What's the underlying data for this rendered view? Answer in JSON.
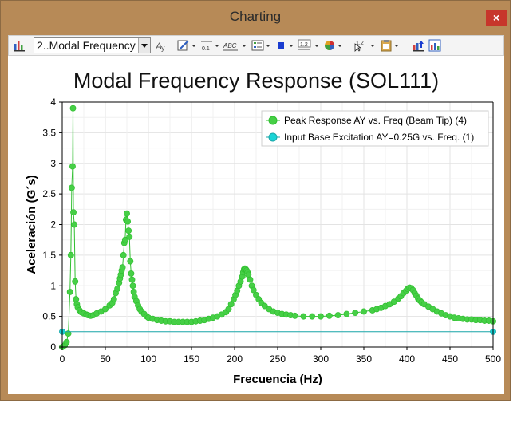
{
  "window": {
    "title": "Charting",
    "close_label": "×"
  },
  "toolbar": {
    "selected_chart": "2..Modal Frequency",
    "icons": [
      "bar-chart-icon",
      "font-icon",
      "edit-icon",
      "axis-format-icon",
      "text-label-icon",
      "legend-icon",
      "marker-icon",
      "range-icon",
      "color-icon",
      "cursor-icon",
      "clipboard-icon",
      "export-icon",
      "chart-settings-icon"
    ],
    "icon_labels": {
      "range": "1.2",
      "cursor": "1.2",
      "axis": "0.1",
      "text": "ABC"
    }
  },
  "colors": {
    "series1": "#2fbf2f",
    "series1_fill": "#46cf46",
    "series2": "#1aa7a9",
    "series2_fill": "#19d4d6",
    "grid": "#e3e3e3"
  },
  "chart_data": {
    "type": "line",
    "title": "Modal Frequency Response (SOL111)",
    "xlabel": "Frecuencia (Hz)",
    "ylabel": "Aceleración (G´s)",
    "xlim": [
      0,
      500
    ],
    "ylim": [
      0,
      4
    ],
    "xticks": [
      "0",
      "50",
      "100",
      "150",
      "200",
      "250",
      "300",
      "350",
      "400",
      "450",
      "500"
    ],
    "yticks": [
      "0",
      "0.5",
      "1",
      "1.5",
      "2",
      "2.5",
      "3",
      "3.5",
      "4"
    ],
    "grid": true,
    "legend_position": "top-right",
    "series": [
      {
        "name": "Peak Response AY vs. Freq (Beam Tip) (4)",
        "x": [
          0,
          3,
          5,
          7,
          9,
          10,
          11,
          12,
          12.5,
          13,
          14,
          15,
          16,
          17,
          18,
          20,
          22,
          25,
          28,
          30,
          33,
          36,
          40,
          45,
          50,
          55,
          58,
          60,
          62,
          64,
          66,
          67,
          68,
          69,
          70,
          71,
          72,
          73,
          74,
          75,
          76,
          77,
          78,
          79,
          80,
          81,
          82,
          83,
          84,
          86,
          88,
          90,
          92,
          95,
          98,
          100,
          105,
          110,
          115,
          120,
          125,
          130,
          135,
          140,
          145,
          150,
          155,
          160,
          165,
          170,
          175,
          180,
          185,
          190,
          193,
          196,
          199,
          201,
          203,
          205,
          207,
          209,
          210,
          211,
          212,
          213,
          214,
          215,
          216,
          218,
          220,
          222,
          225,
          228,
          231,
          235,
          240,
          245,
          250,
          255,
          260,
          265,
          270,
          280,
          290,
          300,
          310,
          320,
          330,
          340,
          350,
          360,
          365,
          370,
          375,
          380,
          385,
          390,
          393,
          396,
          399,
          401,
          403,
          405,
          407,
          409,
          411,
          413,
          415,
          417,
          420,
          425,
          430,
          435,
          440,
          445,
          450,
          455,
          460,
          465,
          470,
          475,
          480,
          485,
          490,
          495,
          500
        ],
        "y": [
          0.0,
          0.03,
          0.08,
          0.22,
          0.9,
          1.5,
          2.6,
          2.95,
          3.9,
          2.2,
          2.0,
          1.07,
          0.78,
          0.7,
          0.65,
          0.6,
          0.57,
          0.55,
          0.53,
          0.52,
          0.51,
          0.52,
          0.55,
          0.58,
          0.62,
          0.68,
          0.72,
          0.78,
          0.88,
          0.95,
          1.05,
          1.12,
          1.18,
          1.25,
          1.3,
          1.5,
          1.7,
          1.75,
          2.08,
          2.18,
          2.05,
          1.9,
          1.8,
          1.4,
          1.2,
          1.1,
          1.0,
          0.9,
          0.82,
          0.75,
          0.68,
          0.62,
          0.58,
          0.54,
          0.5,
          0.48,
          0.46,
          0.44,
          0.43,
          0.42,
          0.42,
          0.41,
          0.41,
          0.41,
          0.41,
          0.41,
          0.42,
          0.43,
          0.44,
          0.46,
          0.48,
          0.5,
          0.53,
          0.57,
          0.62,
          0.7,
          0.78,
          0.85,
          0.92,
          1.0,
          1.07,
          1.15,
          1.22,
          1.27,
          1.28,
          1.27,
          1.25,
          1.22,
          1.18,
          1.1,
          1.0,
          0.93,
          0.85,
          0.78,
          0.72,
          0.67,
          0.62,
          0.58,
          0.56,
          0.54,
          0.53,
          0.52,
          0.51,
          0.5,
          0.5,
          0.5,
          0.51,
          0.52,
          0.54,
          0.56,
          0.58,
          0.6,
          0.62,
          0.64,
          0.67,
          0.7,
          0.74,
          0.79,
          0.83,
          0.88,
          0.92,
          0.95,
          0.97,
          0.96,
          0.93,
          0.88,
          0.84,
          0.79,
          0.76,
          0.73,
          0.7,
          0.66,
          0.62,
          0.58,
          0.55,
          0.52,
          0.5,
          0.48,
          0.47,
          0.46,
          0.45,
          0.45,
          0.44,
          0.44,
          0.43,
          0.43,
          0.42
        ]
      },
      {
        "name": "Input Base Excitation AY=0.25G vs. Freq. (1)",
        "x": [
          0,
          500
        ],
        "y": [
          0.25,
          0.25
        ]
      }
    ]
  }
}
